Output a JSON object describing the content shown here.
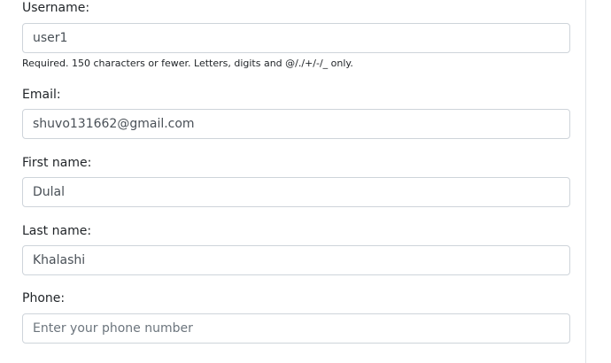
{
  "form": {
    "username": {
      "label": "Username:",
      "value": "user1",
      "help": "Required. 150 characters or fewer. Letters, digits and @/./+/-/_ only."
    },
    "email": {
      "label": "Email:",
      "value": "shuvo131662@gmail.com"
    },
    "first_name": {
      "label": "First name:",
      "value": "Dulal"
    },
    "last_name": {
      "label": "Last name:",
      "value": "Khalashi"
    },
    "phone": {
      "label": "Phone:",
      "value": "",
      "placeholder": "Enter your phone number"
    }
  }
}
